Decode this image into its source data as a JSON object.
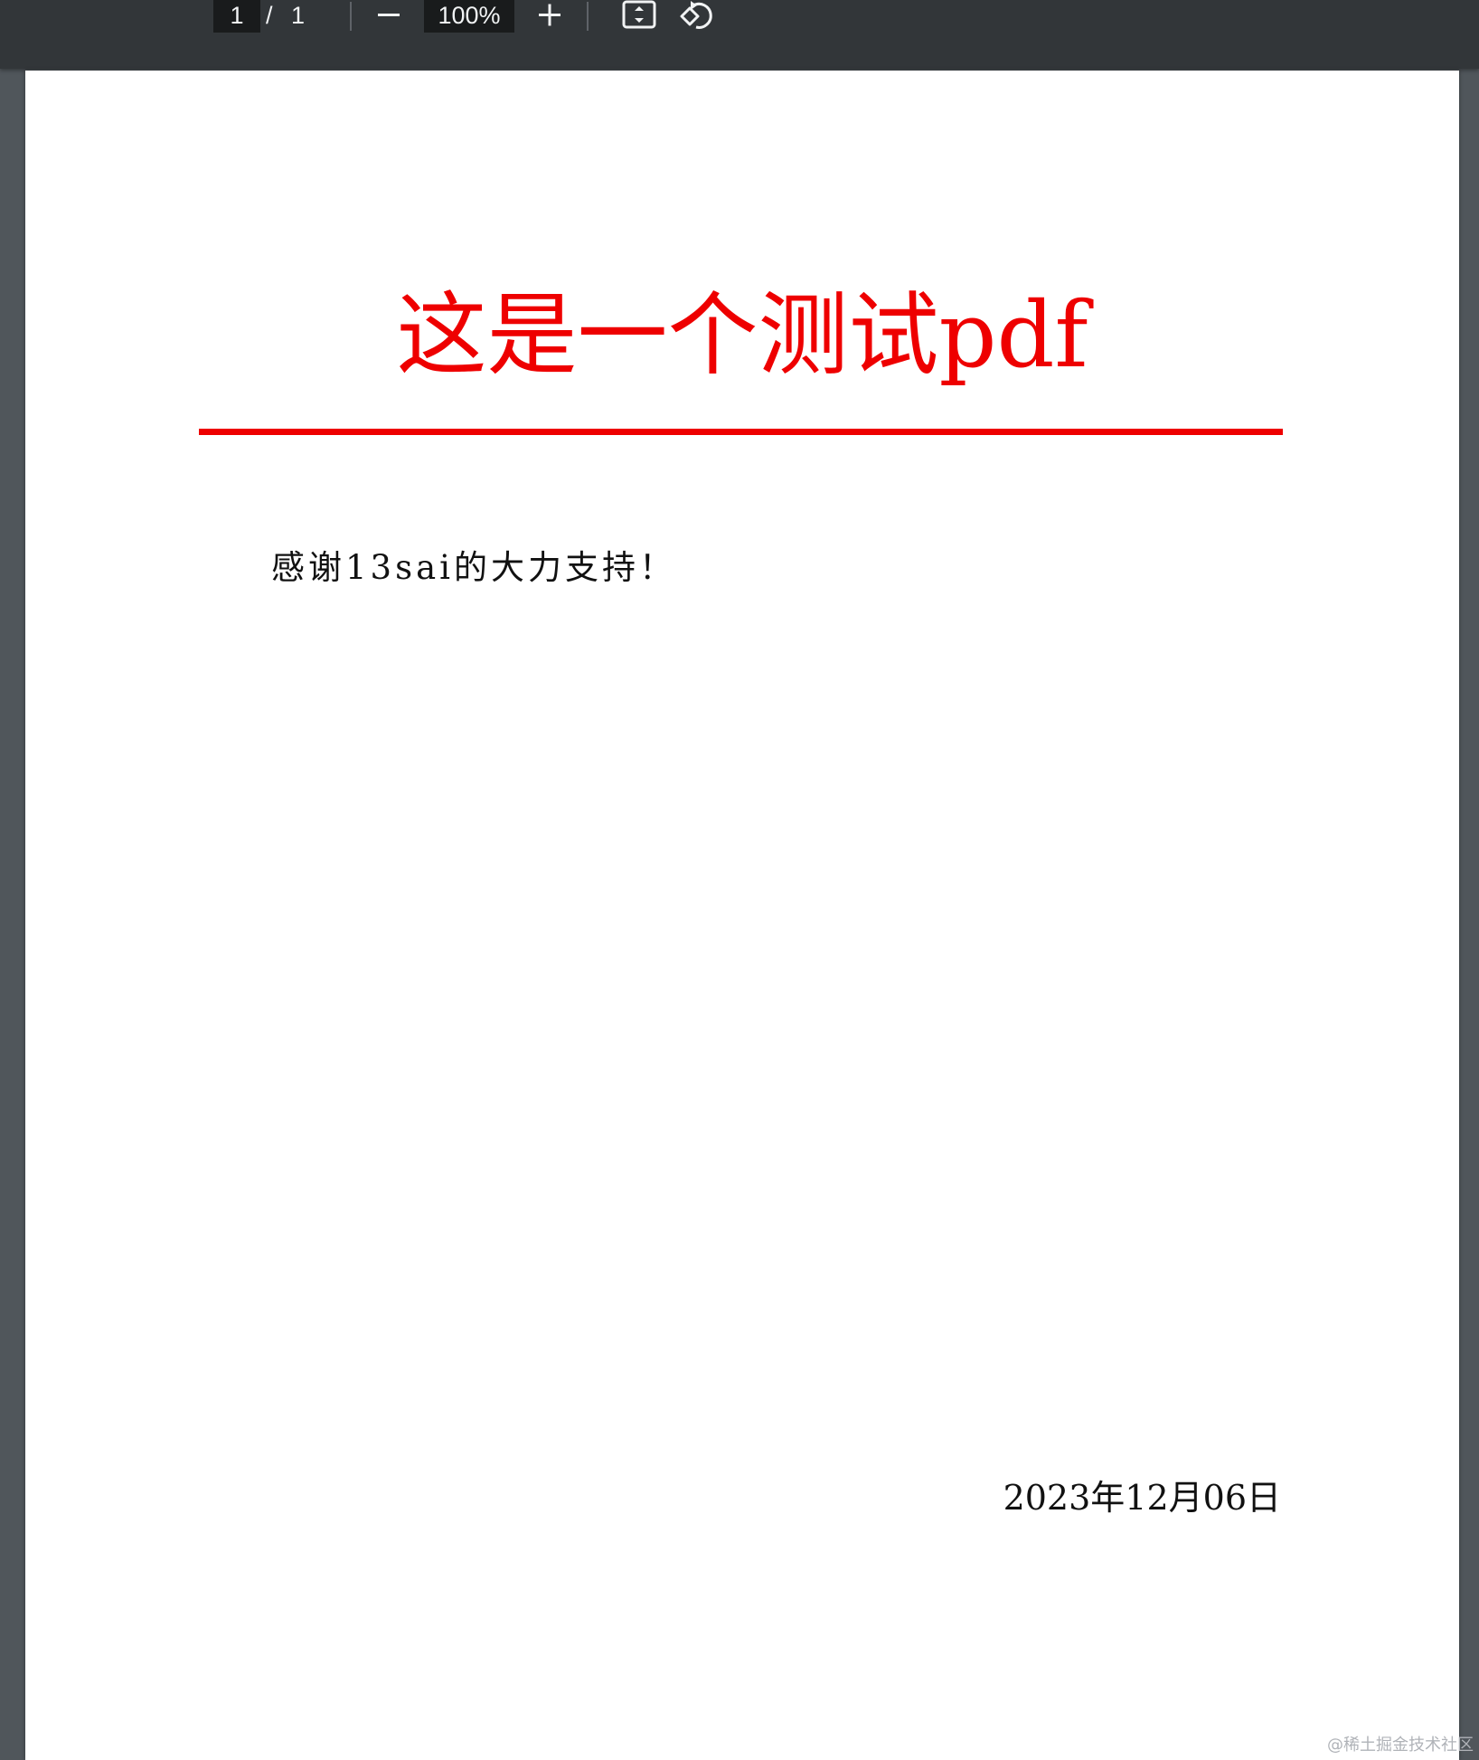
{
  "toolbar": {
    "page_current": "1",
    "page_separator": "/",
    "page_total": "1",
    "zoom_value": "100%",
    "icons": {
      "zoom_out": "minus-icon",
      "zoom_in": "plus-icon",
      "fit": "fit-to-page-icon",
      "rotate": "rotate-counterclockwise-icon"
    }
  },
  "document": {
    "title": "这是一个测试pdf",
    "body": "感谢13sai的大力支持！",
    "date": "2023年12月06日",
    "colors": {
      "title": "#ee0000",
      "rule": "#ee0000",
      "text": "#111111"
    }
  },
  "watermark": "@稀土掘金技术社区"
}
